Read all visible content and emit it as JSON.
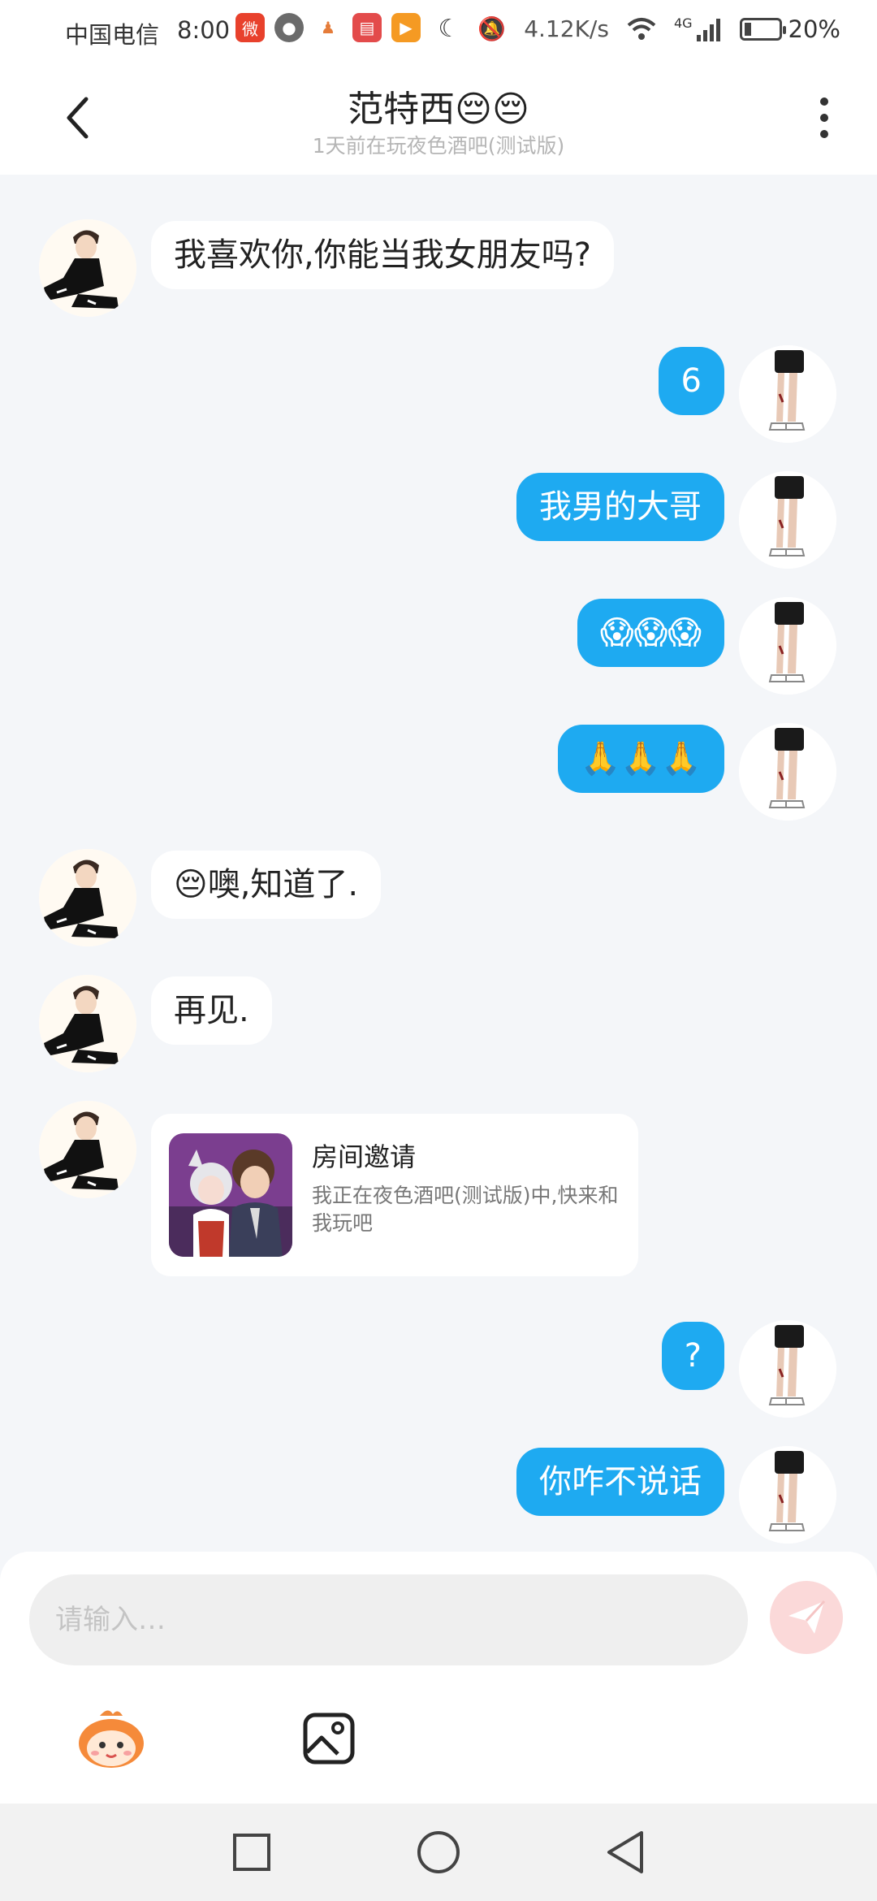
{
  "status_bar": {
    "carrier": "中国电信",
    "time": "8:00",
    "net_speed": "4.12K/s",
    "network": "4G",
    "battery": "20%",
    "battery_level": 0.2
  },
  "header": {
    "title": "范特西😔😔",
    "subtitle": "1天前在玩夜色酒吧(测试版)"
  },
  "messages": [
    {
      "side": "in",
      "type": "text",
      "text": "我喜欢你,你能当我女朋友吗?"
    },
    {
      "side": "out",
      "type": "text",
      "text": "6"
    },
    {
      "side": "out",
      "type": "text",
      "text": "我男的大哥"
    },
    {
      "side": "out",
      "type": "text",
      "text": "😱😱😱"
    },
    {
      "side": "out",
      "type": "text",
      "text": "🙏🙏🙏"
    },
    {
      "side": "in",
      "type": "text",
      "text": "😔噢,知道了."
    },
    {
      "side": "in",
      "type": "text",
      "text": "再见."
    },
    {
      "side": "in",
      "type": "card",
      "title": "房间邀请",
      "desc": "我正在夜色酒吧(测试版)中,快来和我玩吧"
    },
    {
      "side": "out",
      "type": "text",
      "text": "?"
    },
    {
      "side": "out",
      "type": "text",
      "text": "你咋不说话"
    }
  ],
  "composer": {
    "placeholder": "请输入…",
    "value": ""
  },
  "colors": {
    "accent": "#1eaaf1",
    "background": "#f4f6f9",
    "send_button": "#fbd9d9"
  },
  "icons": {
    "back": "chevron-left-icon",
    "more": "more-vertical-icon",
    "send": "paper-plane-icon",
    "sticker": "mascot-sticker-icon",
    "image": "image-icon"
  }
}
